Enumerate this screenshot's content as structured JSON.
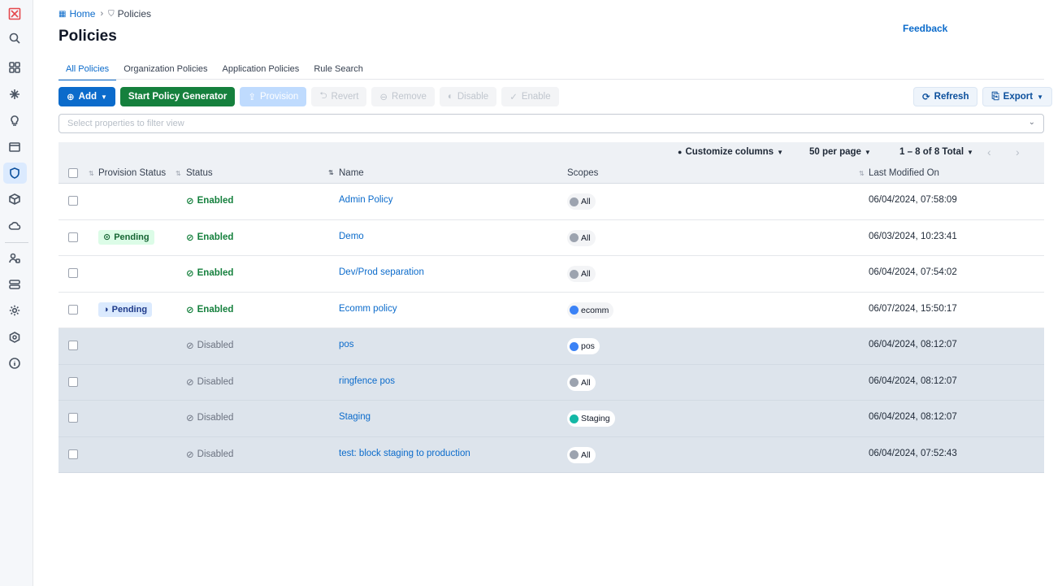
{
  "breadcrumb": {
    "home": "Home",
    "current": "Policies"
  },
  "page": {
    "title": "Policies",
    "feedback": "Feedback"
  },
  "tabs": [
    {
      "label": "All Policies",
      "active": true
    },
    {
      "label": "Organization Policies"
    },
    {
      "label": "Application Policies"
    },
    {
      "label": "Rule Search"
    }
  ],
  "toolbar": {
    "add": "Add",
    "generator": "Start Policy Generator",
    "provision": "Provision",
    "revert": "Revert",
    "remove": "Remove",
    "disable": "Disable",
    "enable": "Enable",
    "refresh": "Refresh",
    "export": "Export"
  },
  "filter": {
    "placeholder": "Select properties to filter view"
  },
  "table_controls": {
    "customize": "Customize columns",
    "per_page": "50 per page",
    "range": "1 – 8 of 8 Total"
  },
  "columns": {
    "provision_status": "Provision Status",
    "status": "Status",
    "name": "Name",
    "scopes": "Scopes",
    "last_modified": "Last Modified On"
  },
  "rows": [
    {
      "provision": "",
      "status": "Enabled",
      "name": "Admin Policy",
      "scope": "All",
      "modified": "06/04/2024, 07:58:09"
    },
    {
      "provision": "Pending",
      "status": "Enabled",
      "name": "Demo",
      "scope": "All",
      "modified": "06/03/2024, 10:23:41"
    },
    {
      "provision": "",
      "status": "Enabled",
      "name": "Dev/Prod separation",
      "scope": "All",
      "modified": "06/04/2024, 07:54:02"
    },
    {
      "provision": "Pending",
      "status": "Enabled",
      "name": "Ecomm policy",
      "scope": "ecomm",
      "modified": "06/07/2024, 15:50:17"
    },
    {
      "provision": "",
      "status": "Disabled",
      "name": "pos",
      "scope": "pos",
      "modified": "06/04/2024, 08:12:07"
    },
    {
      "provision": "",
      "status": "Disabled",
      "name": "ringfence pos",
      "scope": "All",
      "modified": "06/04/2024, 08:12:07"
    },
    {
      "provision": "",
      "status": "Disabled",
      "name": "Staging",
      "scope": "Staging",
      "modified": "06/04/2024, 08:12:07"
    },
    {
      "provision": "",
      "status": "Disabled",
      "name": "test: block staging to production",
      "scope": "All",
      "modified": "06/04/2024, 07:52:43"
    }
  ],
  "colors": {
    "accent": "#0b6bcb",
    "enabled": "#15803d",
    "disabled_row": "#dde4ec"
  }
}
